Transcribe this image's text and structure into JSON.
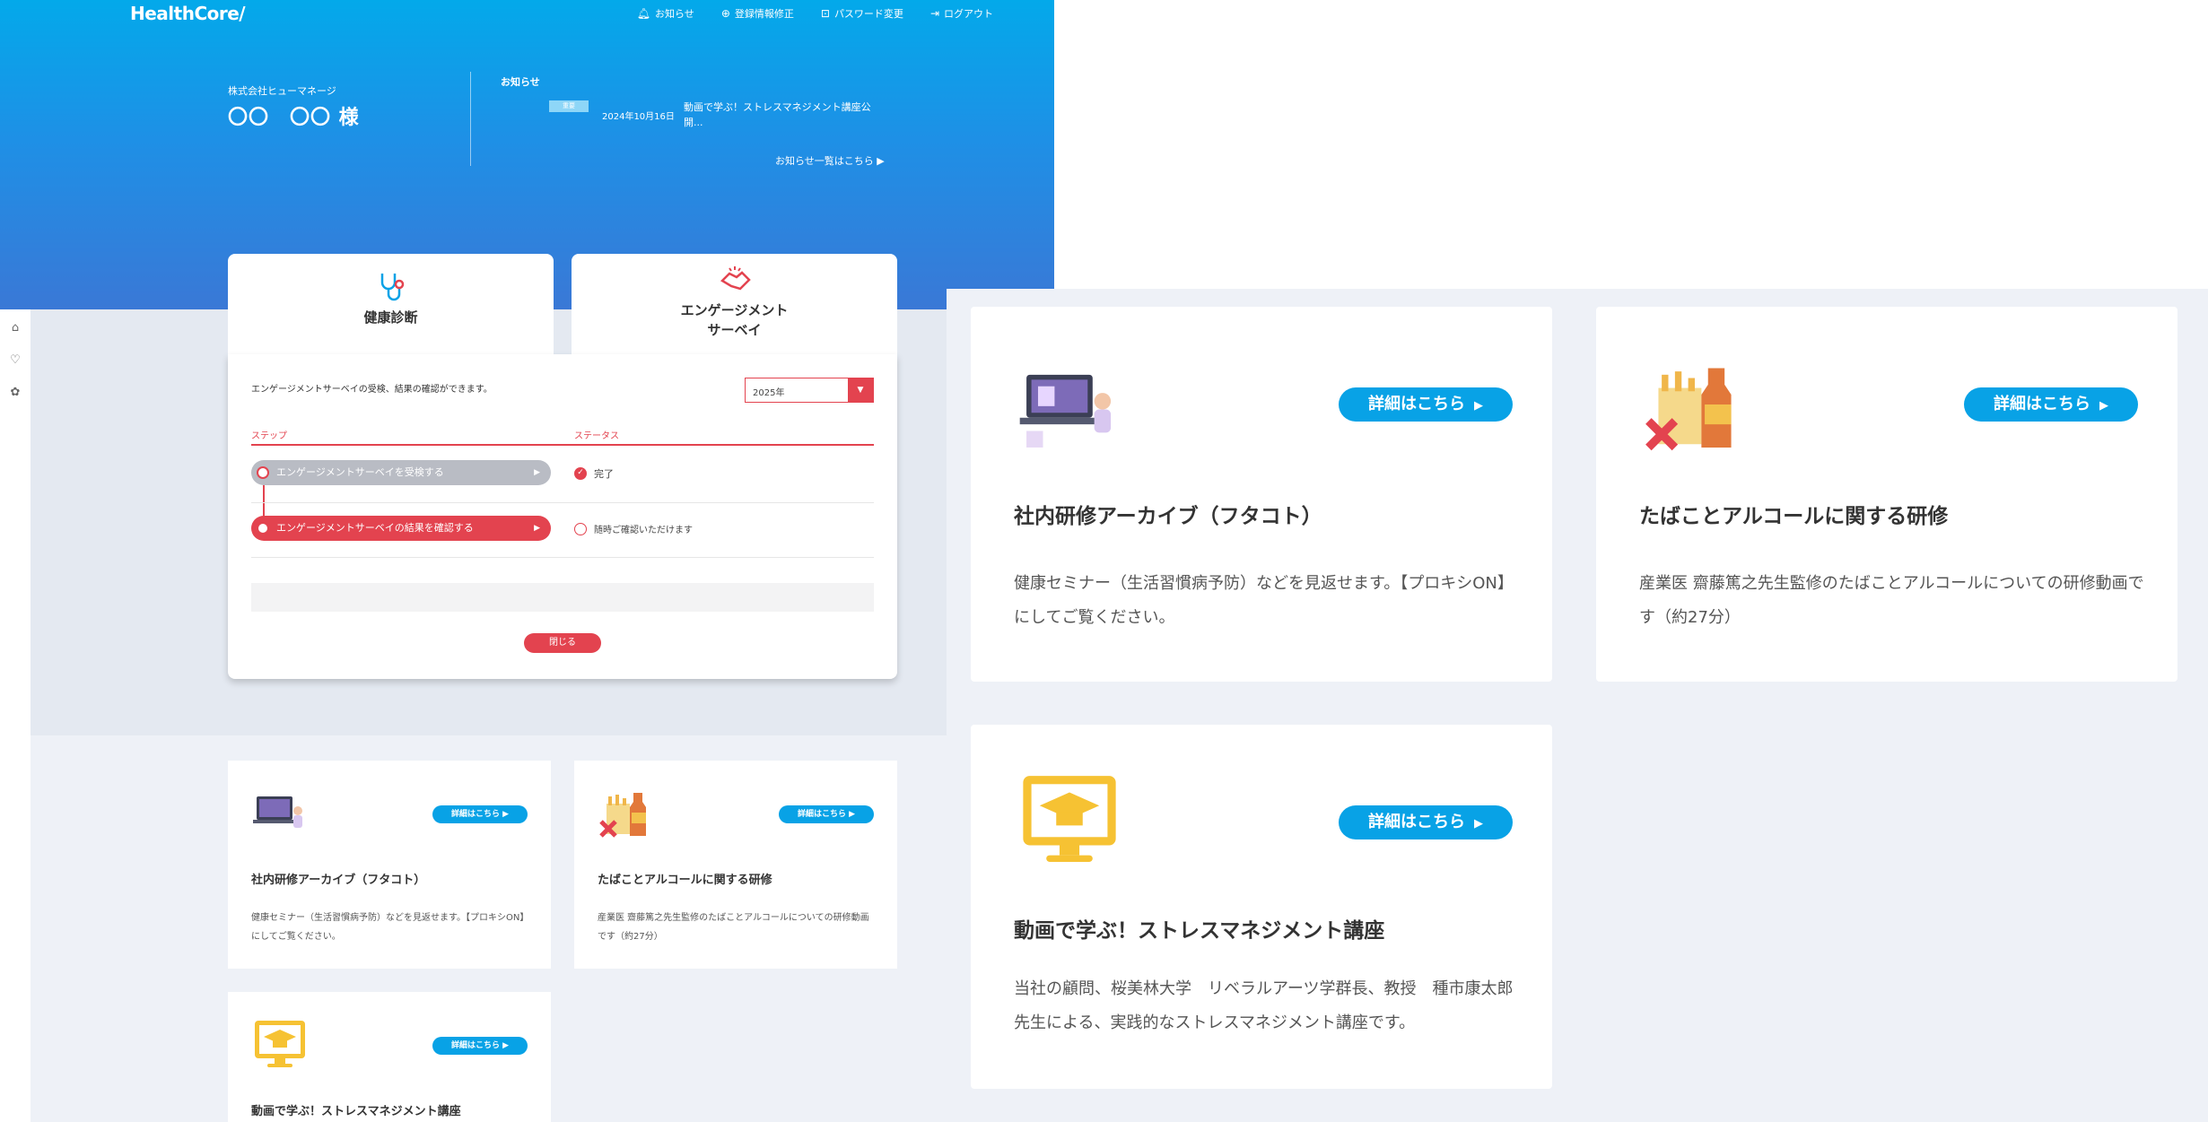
{
  "app": {
    "logo": "HealthCore/"
  },
  "nav": {
    "notice": "お知らせ",
    "profile": "登録情報修正",
    "password": "パスワード変更",
    "logout": "ログアウト"
  },
  "user": {
    "company": "株式会社ヒューマネージ",
    "name": "〇〇　〇〇 様"
  },
  "news": {
    "title": "お知らせ",
    "badge": "重要",
    "date": "2024年10月16日",
    "text": "動画で学ぶ！ストレスマネジメント講座公開...",
    "more": "お知らせ一覧はこちら ▶"
  },
  "tabs": {
    "health": "健康診断",
    "engagement_1": "エンゲージメント",
    "engagement_2": "サーベイ"
  },
  "panel": {
    "description": "エンゲージメントサーベイの受検、結果の確認ができます。",
    "year": "2025年",
    "col_step": "ステップ",
    "col_status": "ステータス",
    "step1": "エンゲージメントサーベイを受検する",
    "step2": "エンゲージメントサーベイの結果を確認する",
    "status1": "完了",
    "status2": "随時ご確認いただけます",
    "close": "閉じる"
  },
  "cards": [
    {
      "title": "社内研修アーカイブ（フタコト）",
      "desc": "健康セミナー（生活習慣病予防）などを見返せます。【プロキシON】にしてご覧ください。",
      "button": "詳細はこちら"
    },
    {
      "title": "たばことアルコールに関する研修",
      "desc": "産業医 齋藤篤之先生監修のたばことアルコールについての研修動画です（約27分）",
      "button": "詳細はこちら"
    },
    {
      "title": "動画で学ぶ！ストレスマネジメント講座",
      "desc": "当社の顧問、桜美林大学　リベラルアーツ学群長、教授　種市康太郎先生による、実践的なストレスマネジメント講座です。",
      "button": "詳細はこちら"
    }
  ],
  "colors": {
    "accent_red": "#e3434f",
    "accent_blue": "#08a2e6",
    "hero_top": "#03a9ea",
    "hero_bottom": "#3a78d6"
  },
  "icons": [
    "bell-icon",
    "user-edit-icon",
    "lock-icon",
    "logout-icon",
    "stethoscope-icon",
    "handshake-icon",
    "home-icon"
  ]
}
